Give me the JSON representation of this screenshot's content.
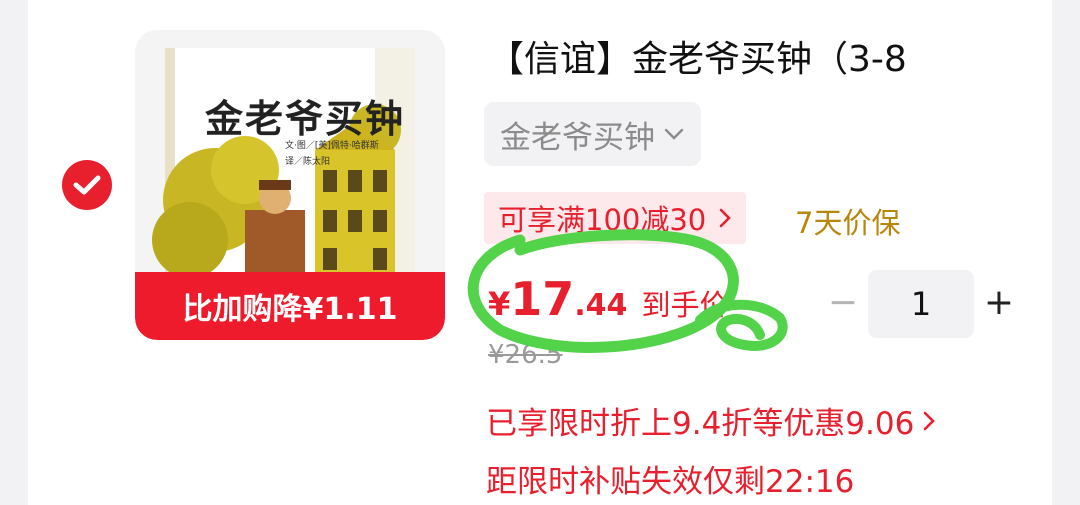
{
  "product": {
    "title": "【信谊】金老爷买钟（3-8",
    "variant_label": "金老爷买钟",
    "variant_icon": "chevron-down-icon",
    "coupon_text": "可享满100减30",
    "coupon_icon": "chevron-right-icon",
    "price_protect": "7天价保",
    "price_currency": "¥",
    "price_integer": "17",
    "price_decimal": ".44",
    "price_tag": "到手价",
    "original_price": "¥26.5",
    "quantity": "1",
    "minus_label": "−",
    "plus_label": "+",
    "discount_text": "已享限时折上9.4折等优惠9.06",
    "discount_icon": "chevron-right-icon",
    "countdown_text": "距限时补贴失效仅剩22:16"
  },
  "thumbnail": {
    "book_title": "金老爷买钟",
    "book_credit_1": "文·图／[美]佩特·哈群斯",
    "book_credit_2": "译／陈太阳",
    "promo_banner": "比加购降¥1.11"
  },
  "colors": {
    "accent_red": "#e8202e",
    "price_protect_gold": "#b8860b",
    "annotation_green": "#52d34a"
  }
}
